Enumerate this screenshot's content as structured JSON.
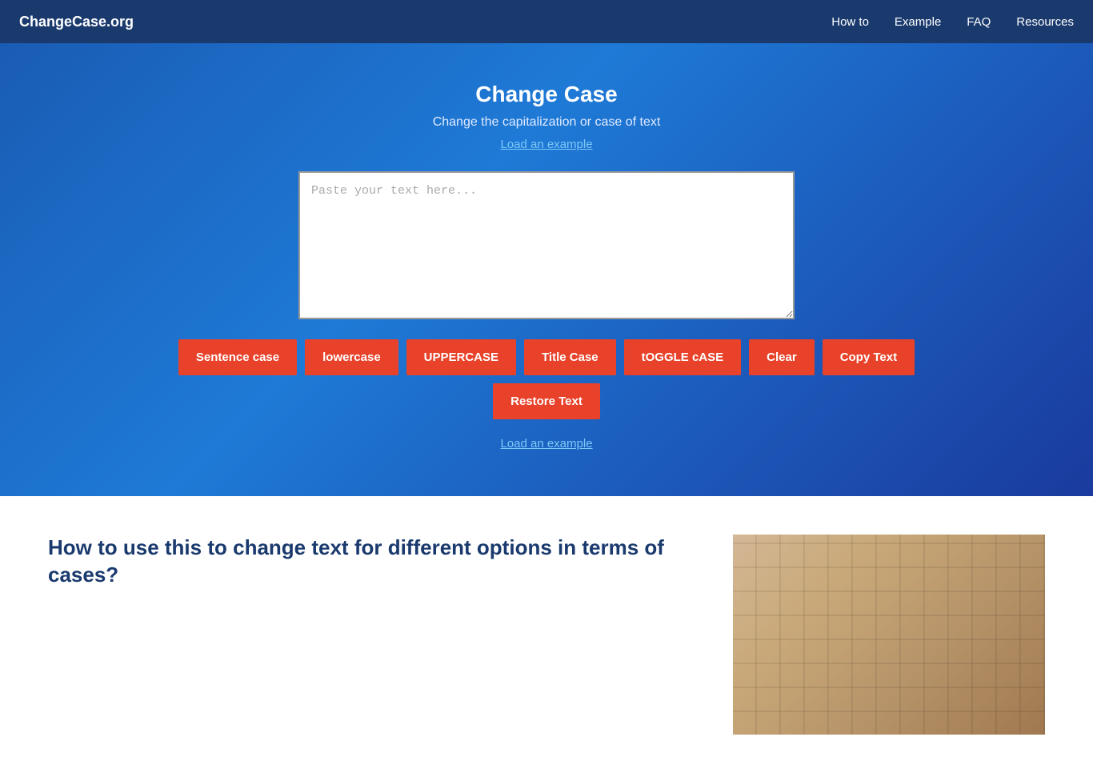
{
  "nav": {
    "brand": "ChangeCase.org",
    "links": [
      {
        "label": "How to",
        "href": "#"
      },
      {
        "label": "Example",
        "href": "#"
      },
      {
        "label": "FAQ",
        "href": "#"
      },
      {
        "label": "Resources",
        "href": "#"
      }
    ]
  },
  "hero": {
    "title": "Change Case",
    "subtitle": "Change the capitalization or case of text",
    "load_example_link": "Load an example",
    "textarea_placeholder": "Paste your text here..."
  },
  "buttons": [
    {
      "label": "Sentence case",
      "name": "sentence-case-button"
    },
    {
      "label": "lowercase",
      "name": "lowercase-button"
    },
    {
      "label": "UPPERCASE",
      "name": "uppercase-button"
    },
    {
      "label": "Title Case",
      "name": "title-case-button"
    },
    {
      "label": "tOGGLE cASE",
      "name": "toggle-case-button"
    },
    {
      "label": "Clear",
      "name": "clear-button"
    },
    {
      "label": "Copy Text",
      "name": "copy-text-button"
    },
    {
      "label": "Restore Text",
      "name": "restore-text-button"
    }
  ],
  "load_example_bottom": "Load an example",
  "content": {
    "heading": "How to use this to change text for different options in terms of cases?"
  }
}
